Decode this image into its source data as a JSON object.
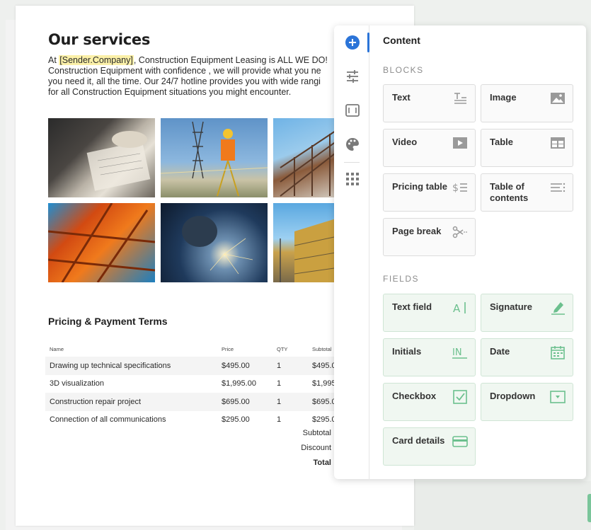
{
  "document": {
    "title": "Our services",
    "intro": {
      "line1_before": "At ",
      "line1_var": "[Sender.Company]",
      "line1_after": ", Construction Equipment Leasing is ALL WE DO!",
      "line2": "Construction Equipment with confidence , we will provide what you ne",
      "line3": "you need it, all the time. Our 24/7 hotline provides you with wide rangi",
      "line4": "for all Construction Equipment situations you might encounter."
    },
    "pricing": {
      "title": "Pricing & Payment Terms",
      "headers": [
        "Name",
        "Price",
        "QTY",
        "Subtotal"
      ],
      "rows": [
        [
          "Drawing up technical specifications",
          "$495.00",
          "1",
          "$495.0"
        ],
        [
          "3D visualization",
          "$1,995.00",
          "1",
          "$1,995"
        ],
        [
          "Construction repair project",
          "$695.00",
          "1",
          "$695.0"
        ],
        [
          "Connection of all communications",
          "$295.00",
          "1",
          "$295.0"
        ]
      ],
      "subtotal_label": "Subtotal",
      "discount_label": "Discount",
      "total_label": "Total"
    }
  },
  "panel": {
    "title": "Content",
    "blocks_label": "BLOCKS",
    "fields_label": "FIELDS",
    "blocks": [
      {
        "label": "Text",
        "icon": "text-block-icon"
      },
      {
        "label": "Image",
        "icon": "image-icon"
      },
      {
        "label": "Video",
        "icon": "video-icon"
      },
      {
        "label": "Table",
        "icon": "table-icon"
      },
      {
        "label": "Pricing table",
        "icon": "pricing-table-icon"
      },
      {
        "label": "Table of contents",
        "icon": "table-of-contents-icon"
      },
      {
        "label": "Page break",
        "icon": "page-break-icon"
      }
    ],
    "fields": [
      {
        "label": "Text field",
        "icon": "text-field-icon"
      },
      {
        "label": "Signature",
        "icon": "signature-icon"
      },
      {
        "label": "Initials",
        "icon": "initials-icon"
      },
      {
        "label": "Date",
        "icon": "calendar-icon"
      },
      {
        "label": "Checkbox",
        "icon": "checkbox-icon"
      },
      {
        "label": "Dropdown",
        "icon": "dropdown-icon"
      },
      {
        "label": "Card details",
        "icon": "credit-card-icon"
      }
    ],
    "rail": [
      "add-content-icon",
      "settings-sliders-icon",
      "variables-icon",
      "palette-icon",
      "apps-grid-icon"
    ]
  },
  "colors": {
    "accent": "#2b74d8",
    "field_green": "#6cc08e",
    "variable_highlight": "#fbf0a8"
  }
}
